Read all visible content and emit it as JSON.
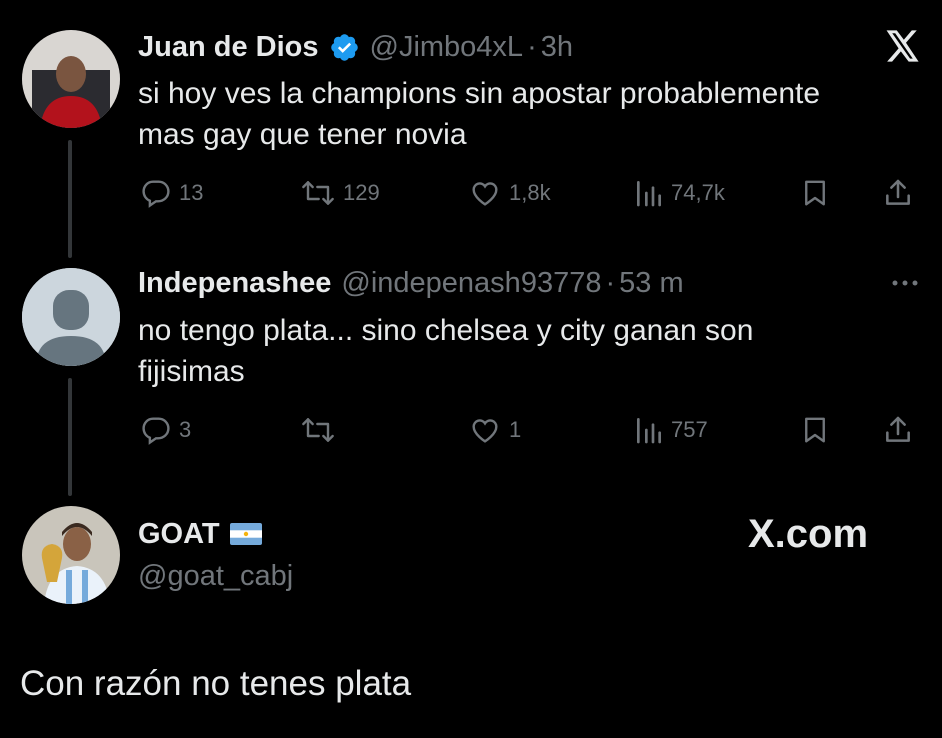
{
  "tweets": [
    {
      "name": "Juan de Dios",
      "handle": "@Jimbo4xL",
      "time": "3h",
      "text_line1": "si hoy ves la champions sin apostar probablemente",
      "text_line2": "mas gay que tener novia",
      "replies": "13",
      "retweets": "129",
      "likes": "1,8k",
      "views": "74,7k"
    },
    {
      "name": "Indepenashee",
      "handle": "@indepenash93778",
      "time": "53 m",
      "text_line1": "no tengo plata... sino chelsea y city ganan son",
      "text_line2": "fijisimas",
      "replies": "3",
      "retweets": "",
      "likes": "1",
      "views": "757"
    }
  ],
  "quote": {
    "name": "GOAT",
    "flag": "🇦🇷",
    "handle": "@goat_cabj",
    "brand": "X.com",
    "text": "Con razón no tenes plata"
  },
  "colors": {
    "background": "#000000",
    "text": "#e7e9ea",
    "muted": "#71767b",
    "verified": "#1d9bf0"
  },
  "icons": [
    "x-logo-icon",
    "verified-badge-icon",
    "reply-icon",
    "retweet-icon",
    "like-icon",
    "views-icon",
    "bookmark-icon",
    "share-icon",
    "more-icon"
  ]
}
